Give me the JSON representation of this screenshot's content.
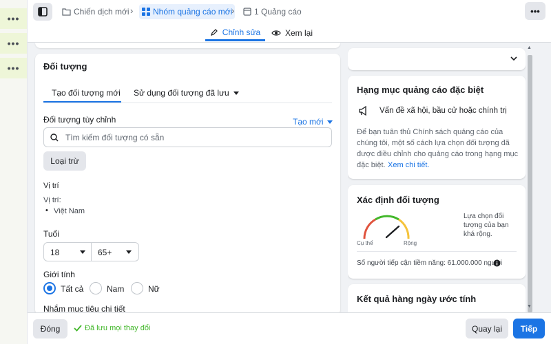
{
  "breadcrumb": {
    "campaign": "Chiến dịch mới",
    "adset": "Nhóm quảng cáo mới",
    "ad": "1 Quảng cáo"
  },
  "mode_tabs": {
    "edit": "Chỉnh sửa",
    "review": "Xem lại"
  },
  "audience": {
    "title": "Đối tượng",
    "tabs": {
      "create": "Tạo đối tượng mới",
      "saved": "Sử dụng đối tượng đã lưu"
    },
    "custom_label": "Đối tượng tùy chỉnh",
    "create_new": "Tạo mới",
    "search_placeholder": "Tìm kiếm đối tượng có sẵn",
    "exclude_button": "Loại trừ",
    "location_heading": "Vị trí",
    "location_label": "Vị trí:",
    "location_value": "Việt Nam",
    "age_heading": "Tuổi",
    "age_min": "18",
    "age_max": "65+",
    "gender_heading": "Giới tính",
    "gender_options": [
      "Tất cả",
      "Nam",
      "Nữ"
    ],
    "detailed_heading": "Nhắm mục tiêu chi tiết"
  },
  "special_ads": {
    "title": "Hạng mục quảng cáo đặc biệt",
    "category": "Vấn đề xã hội, bầu cử hoặc chính trị",
    "description_lines": [
      "Để bạn tuân thủ Chính sách quảng cáo của",
      "chúng tôi, một số cách lựa chọn đối tượng đã",
      "được điều chỉnh cho quảng cáo trong hạng mục",
      "đặc biệt."
    ],
    "link": "Xem chi tiết."
  },
  "audience_def": {
    "title": "Xác định đối tượng",
    "specific": "Cụ thể",
    "broad": "Rộng",
    "note_lines": [
      "Lựa chọn đối",
      "tượng của bạn",
      "khá rộng."
    ],
    "reach": "Số người tiếp cận tiềm năng: 61.000.000 người"
  },
  "daily_results": {
    "title": "Kết quả hàng ngày ước tính"
  },
  "footer": {
    "close": "Đóng",
    "saved": "Đã lưu mọi thay đổi",
    "back": "Quay lại",
    "next": "Tiếp"
  },
  "colors": {
    "accent": "#1b74e4",
    "gauge_red": "#e0533d",
    "gauge_green": "#42b72a",
    "gauge_yellow": "#f5c33b"
  }
}
